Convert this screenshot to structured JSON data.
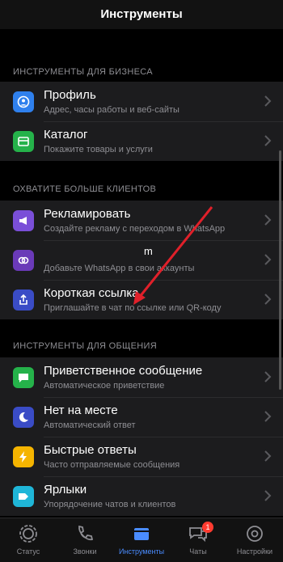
{
  "header": {
    "title": "Инструменты"
  },
  "sections": [
    {
      "title": "ИНСТРУМЕНТЫ ДЛЯ БИЗНЕСА",
      "items": [
        {
          "label": "Профиль",
          "subtitle": "Адрес, часы работы и веб-сайты",
          "icon": "profile-icon",
          "color": "#2f80ed"
        },
        {
          "label": "Каталог",
          "subtitle": "Покажите товары и услуги",
          "icon": "store-icon",
          "color": "#25b24a"
        }
      ]
    },
    {
      "title": "ОХВАТИТЕ БОЛЬШЕ КЛИЕНТОВ",
      "items": [
        {
          "label": "Рекламировать",
          "subtitle": "Создайте рекламу с переходом в WhatsApp",
          "icon": "megaphone-icon",
          "color": "#7a4fd8"
        },
        {
          "label": "m",
          "subtitle": "Добавьте WhatsApp в свои аккаунты",
          "icon": "link-icon",
          "color": "#6a3ab8"
        },
        {
          "label": "Короткая ссылка",
          "subtitle": "Приглашайте в чат по ссылке или QR-коду",
          "icon": "share-icon",
          "color": "#3a4cc6"
        }
      ]
    },
    {
      "title": "ИНСТРУМЕНТЫ ДЛЯ ОБЩЕНИЯ",
      "items": [
        {
          "label": "Приветственное сообщение",
          "subtitle": "Автоматическое приветствие",
          "icon": "message-icon",
          "color": "#25b24a"
        },
        {
          "label": "Нет на месте",
          "subtitle": "Автоматический ответ",
          "icon": "moon-icon",
          "color": "#3a4cc6"
        },
        {
          "label": "Быстрые ответы",
          "subtitle": "Часто отправляемые сообщения",
          "icon": "bolt-icon",
          "color": "#f5b400"
        },
        {
          "label": "Ярлыки",
          "subtitle": "Упорядочение чатов и клиентов",
          "icon": "tag-icon",
          "color": "#1fb6d8"
        }
      ]
    }
  ],
  "tabbar": {
    "tabs": [
      {
        "label": "Статус",
        "icon": "status-icon"
      },
      {
        "label": "Звонки",
        "icon": "phone-icon"
      },
      {
        "label": "Инструменты",
        "icon": "tools-icon",
        "active": true
      },
      {
        "label": "Чаты",
        "icon": "chats-icon",
        "badge": "1"
      },
      {
        "label": "Настройки",
        "icon": "gear-icon"
      }
    ]
  },
  "colors": {
    "accent": "#4a8cff",
    "annotation_arrow": "#e0202a"
  }
}
